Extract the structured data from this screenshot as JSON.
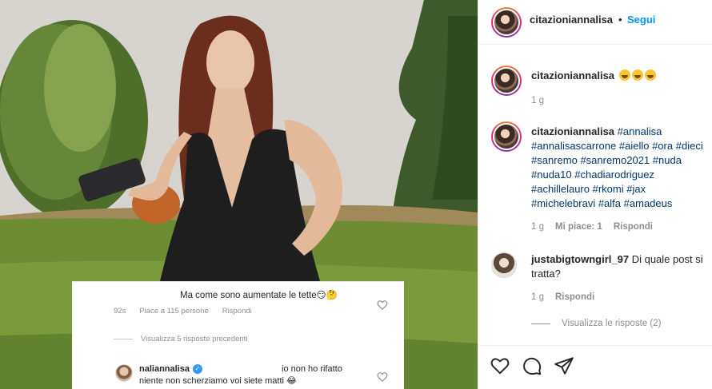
{
  "post": {
    "author": "citazioniannalisa",
    "follow_label": "Segui",
    "separator": "•"
  },
  "overlay": {
    "comment_text": "Ma come sono aumentate le tette😏🤔",
    "time": "92s",
    "likes": "Piace a 115 persone",
    "reply_label": "Rispondi",
    "view_replies": "Visualizza 5 risposte precedenti",
    "reply_user": "naliannalisa",
    "reply_text_line1": "io non ho rifatto",
    "reply_text_line2": "niente non scherziamo voi siete matti 😂"
  },
  "comments": [
    {
      "user": "citazioniannalisa",
      "time": "1 g"
    },
    {
      "user": "citazioniannalisa",
      "tags": [
        "#annalisa",
        "#annalisascarrone",
        "#aiello",
        "#ora",
        "#dieci",
        "#sanremo",
        "#sanremo2021",
        "#nuda",
        "#nuda10",
        "#chadiarodriguez",
        "#achillelauro",
        "#rkomi",
        "#jax",
        "#michelebravi",
        "#alfa",
        "#amadeus"
      ],
      "time": "1 g",
      "likes": "Mi piace: 1",
      "reply_label": "Rispondi"
    },
    {
      "user": "justabigtowngirl_97",
      "text": "Di quale post si tratta?",
      "time": "1 g",
      "reply_label": "Rispondi"
    }
  ],
  "view_replies": "Visualizza le risposte (2)",
  "icons": [
    "heart-icon",
    "comment-icon",
    "share-icon"
  ],
  "colors": {
    "link": "#0095f6",
    "tag": "#00376b",
    "muted": "#8e8e8e"
  }
}
